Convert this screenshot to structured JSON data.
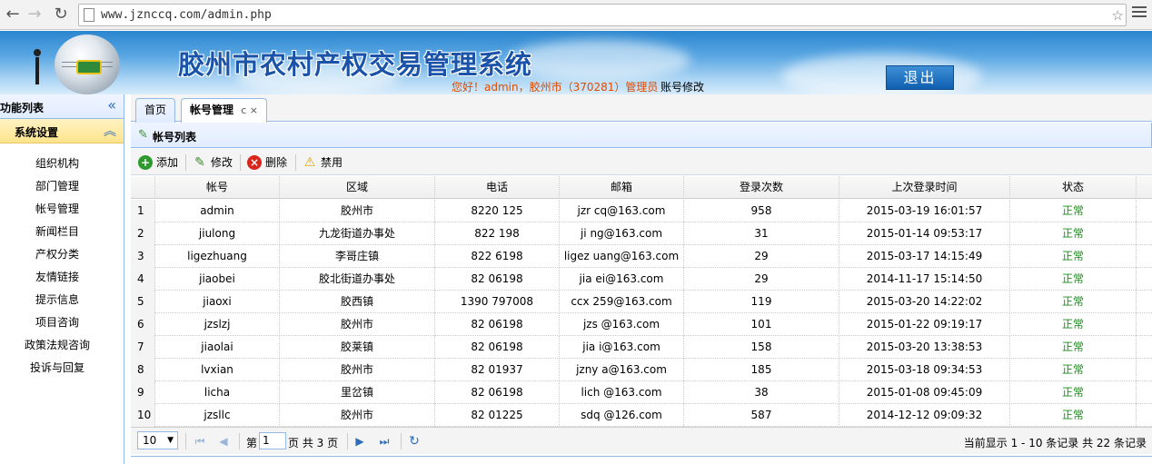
{
  "browser": {
    "url": "www.jznccq.com/admin.php"
  },
  "header": {
    "title": "胶州市农村产权交易管理系统",
    "welcome": "您好！admin，胶州市（370281）管理员",
    "edit_account": "账号修改",
    "logout": "退出"
  },
  "sidebar": {
    "title": "功能列表",
    "section": "系统设置",
    "items": [
      "组织机构",
      "部门管理",
      "帐号管理",
      "新闻栏目",
      "产权分类",
      "友情链接",
      "提示信息",
      "项目咨询",
      "政策法规咨询",
      "投诉与回复"
    ]
  },
  "tabs": [
    {
      "label": "首页"
    },
    {
      "label": "帐号管理",
      "tools": "c ×"
    }
  ],
  "panel": {
    "title": "帐号列表"
  },
  "toolbar": {
    "add": "添加",
    "edit": "修改",
    "delete": "删除",
    "disable": "禁用"
  },
  "table": {
    "columns": [
      "帐号",
      "区域",
      "电话",
      "邮箱",
      "登录次数",
      "上次登录时间",
      "状态"
    ],
    "rows": [
      {
        "num": "1",
        "account": "admin",
        "area": "胶州市",
        "phone": "8220  125",
        "email": "jzr   cq@163.com",
        "logins": "958",
        "last_login": "2015-03-19 16:01:57",
        "status": "正常"
      },
      {
        "num": "2",
        "account": "jiulong",
        "area": "九龙街道办事处",
        "phone": "822   198",
        "email": "ji   ng@163.com",
        "logins": "31",
        "last_login": "2015-01-14 09:53:17",
        "status": "正常"
      },
      {
        "num": "3",
        "account": "ligezhuang",
        "area": "李哥庄镇",
        "phone": "822  6198",
        "email": "ligez  uang@163.com",
        "logins": "29",
        "last_login": "2015-03-17 14:15:49",
        "status": "正常"
      },
      {
        "num": "4",
        "account": "jiaobei",
        "area": "胶北街道办事处",
        "phone": "82  06198",
        "email": "jia   ei@163.com",
        "logins": "29",
        "last_login": "2014-11-17 15:14:50",
        "status": "正常"
      },
      {
        "num": "5",
        "account": "jiaoxi",
        "area": "胶西镇",
        "phone": "1390  797008",
        "email": "ccx   259@163.com",
        "logins": "119",
        "last_login": "2015-03-20 14:22:02",
        "status": "正常"
      },
      {
        "num": "6",
        "account": "jzslzj",
        "area": "胶州市",
        "phone": "82  06198",
        "email": "jzs   @163.com",
        "logins": "101",
        "last_login": "2015-01-22 09:19:17",
        "status": "正常"
      },
      {
        "num": "7",
        "account": "jiaolai",
        "area": "胶莱镇",
        "phone": "82  06198",
        "email": "jia   i@163.com",
        "logins": "158",
        "last_login": "2015-03-20 13:38:53",
        "status": "正常"
      },
      {
        "num": "8",
        "account": "lvxian",
        "area": "胶州市",
        "phone": "82  01937",
        "email": "jzny   a@163.com",
        "logins": "185",
        "last_login": "2015-03-18 09:34:53",
        "status": "正常"
      },
      {
        "num": "9",
        "account": "licha",
        "area": "里岔镇",
        "phone": "82  06198",
        "email": "lich  @163.com",
        "logins": "38",
        "last_login": "2015-01-08 09:45:09",
        "status": "正常"
      },
      {
        "num": "10",
        "account": "jzsllc",
        "area": "胶州市",
        "phone": "82  01225",
        "email": "sdq   @126.com",
        "logins": "587",
        "last_login": "2014-12-12 09:09:32",
        "status": "正常"
      }
    ]
  },
  "pager": {
    "page_size": "10",
    "page_prefix": "第",
    "page": "1",
    "page_suffix": "页 共 3 页",
    "info": "当前显示 1 - 10 条记录 共 22 条记录"
  }
}
